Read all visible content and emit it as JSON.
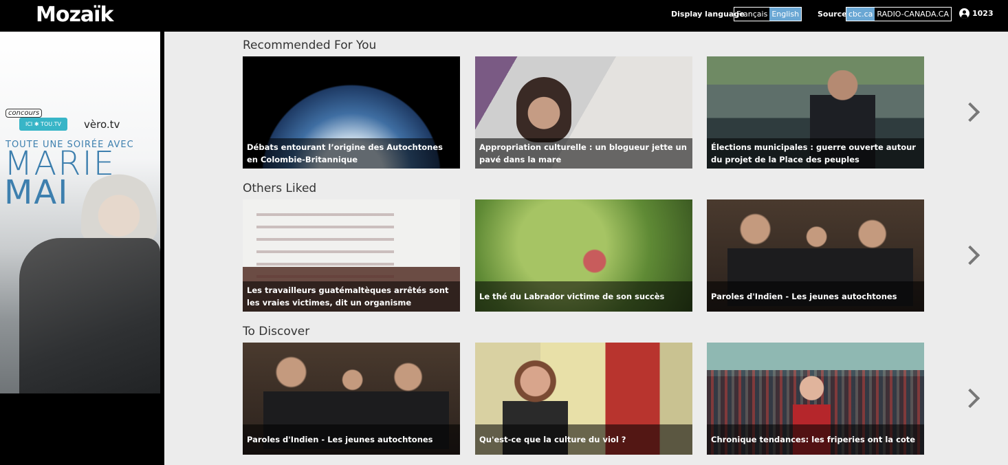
{
  "header": {
    "logo": "Mozaïk",
    "display_language_label": "Display language",
    "languages": [
      {
        "label": "Français",
        "active": false
      },
      {
        "label": "English",
        "active": true
      }
    ],
    "source_label": "Source:",
    "sources": [
      {
        "label": "cbc.ca",
        "active": true
      },
      {
        "label": "RADIO-CANADA.CA",
        "active": false
      }
    ],
    "user_count": "1023",
    "user_icon": "user-circle-icon"
  },
  "ad": {
    "concours": "concours",
    "ici_tou_tv": "ICI ✱ TOU.TV",
    "vero_tv": "vèro.tv",
    "headline": "TOUTE UNE SOIRÉE AVEC",
    "name_line1": "MARIE",
    "name_line2": "MAI"
  },
  "sections": [
    {
      "title": "Recommended For You",
      "cards": [
        {
          "caption": "Débats entourant l’origine des Autochtones en Colombie-Britannique"
        },
        {
          "caption": "Appropriation culturelle : un blogueur jette un pavé dans la mare"
        },
        {
          "caption": "Élections municipales : guerre ouverte autour du projet de la Place des peuples"
        }
      ]
    },
    {
      "title": "Others Liked",
      "cards": [
        {
          "caption": "Les travailleurs guatémaltèques arrêtés sont les vraies victimes, dit un organisme"
        },
        {
          "caption": "Le thé du Labrador victime de son succès"
        },
        {
          "caption": "Paroles d'Indien - Les jeunes autochtones"
        }
      ]
    },
    {
      "title": "To Discover",
      "cards": [
        {
          "caption": "Paroles d'Indien - Les jeunes autochtones"
        },
        {
          "caption": "Qu'est-ce que la culture du viol ?"
        },
        {
          "caption": "Chronique tendances: les friperies ont la cote"
        }
      ]
    }
  ],
  "colors": {
    "accent": "#6aa7d4",
    "background": "#ececec",
    "header": "#000000"
  }
}
